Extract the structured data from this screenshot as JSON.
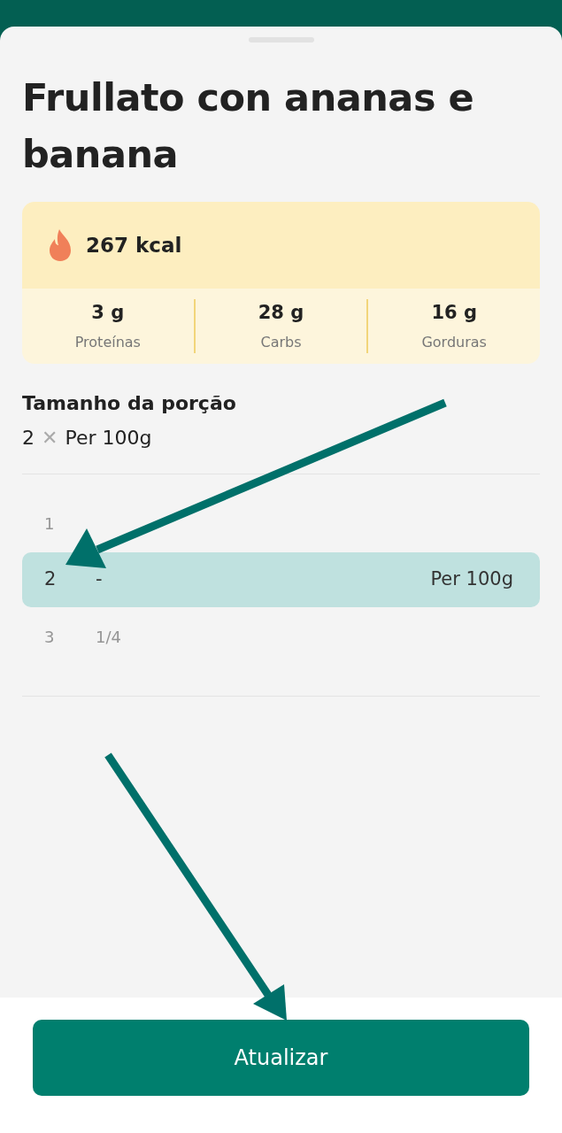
{
  "title": "Frullato con ananas e banana",
  "nutrition": {
    "calories": "267 kcal",
    "macros": [
      {
        "value": "3 g",
        "label": "Proteínas"
      },
      {
        "value": "28 g",
        "label": "Carbs"
      },
      {
        "value": "16 g",
        "label": "Gorduras"
      }
    ]
  },
  "serving": {
    "heading": "Tamanho da porção",
    "amount": "2",
    "times": "✕",
    "unit": "Per 100g"
  },
  "picker": [
    {
      "amount": "1",
      "selected": false
    },
    {
      "amount": "2",
      "fraction": "-",
      "unit": "Per 100g",
      "selected": true
    },
    {
      "amount": "3",
      "fraction": "1/4",
      "selected": false
    }
  ],
  "button": "Atualizar"
}
